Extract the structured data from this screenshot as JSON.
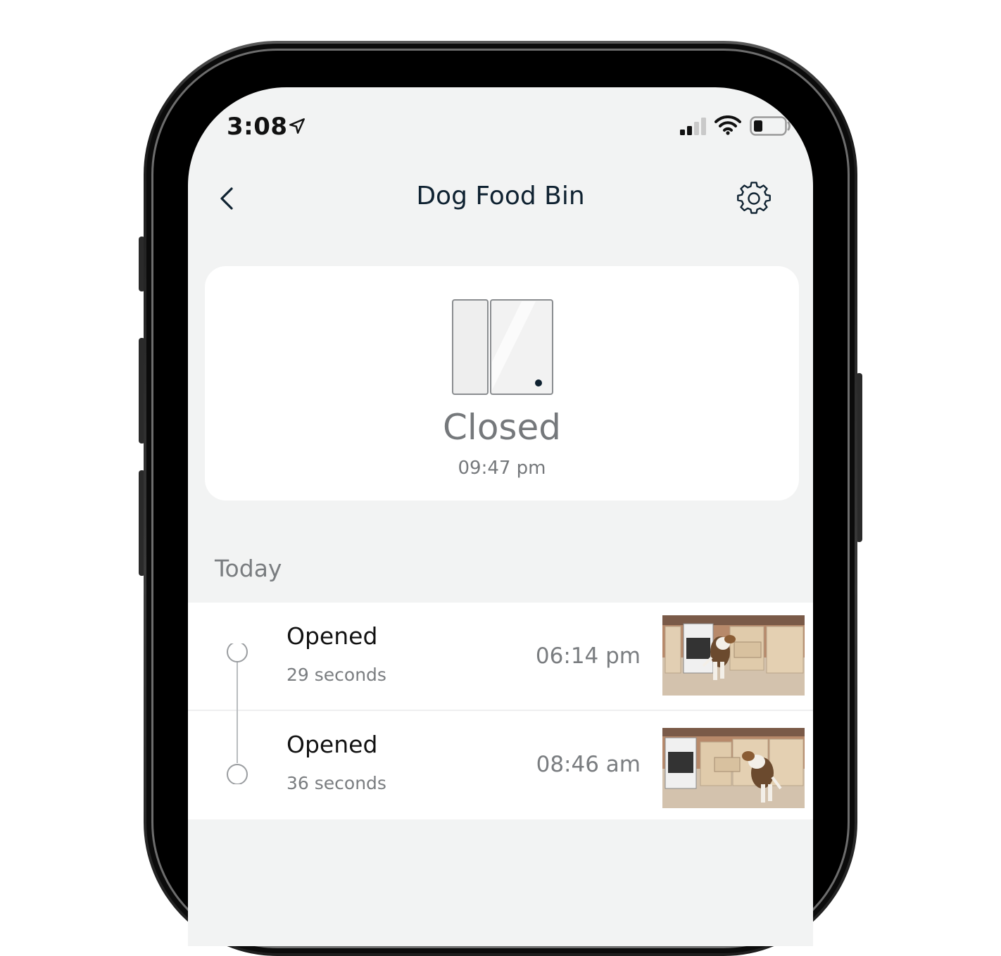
{
  "status_bar": {
    "time": "3:08",
    "icons": [
      "location-arrow-icon",
      "signal-icon",
      "wifi-icon",
      "battery-icon"
    ]
  },
  "nav": {
    "title": "Dog Food Bin",
    "back_icon": "chevron-left-icon",
    "settings_icon": "gear-icon"
  },
  "sensor": {
    "state": "Closed",
    "time": "09:47 pm",
    "icon": "door-sensor-icon"
  },
  "history": {
    "section_label": "Today",
    "events": [
      {
        "title": "Opened",
        "duration": "29 seconds",
        "time": "06:14 pm",
        "thumbnail": "kitchen-camera-snapshot"
      },
      {
        "title": "Opened",
        "duration": "36 seconds",
        "time": "08:46 am",
        "thumbnail": "kitchen-camera-snapshot"
      }
    ]
  },
  "colors": {
    "screen_bg": "#f2f3f3",
    "title_text": "#0f2231",
    "muted_text": "#7a7d80",
    "card_bg": "#ffffff"
  }
}
